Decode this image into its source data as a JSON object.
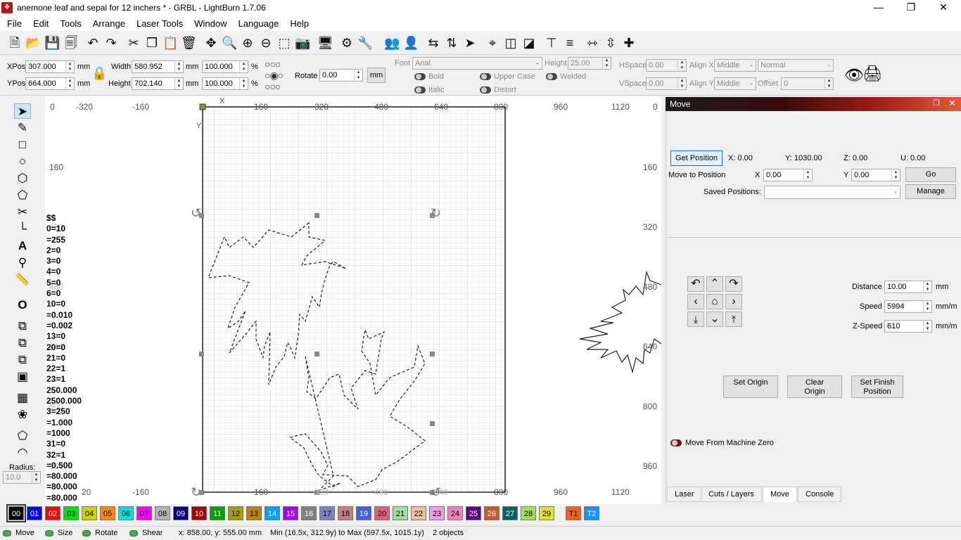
{
  "window": {
    "title": "anemone leaf and sepal for 12 inchers * - GRBL - LightBurn 1.7.06",
    "minimize": "—",
    "maximize": "❐",
    "close": "✕"
  },
  "menu": [
    "File",
    "Edit",
    "Tools",
    "Arrange",
    "Laser Tools",
    "Window",
    "Language",
    "Help"
  ],
  "props": {
    "xpos_label": "XPos",
    "xpos": "307.000",
    "ypos_label": "YPos",
    "ypos": "664.000",
    "unit": "mm",
    "width_label": "Width",
    "width": "580.952",
    "height_label": "Height",
    "height": "702.140",
    "wpct": "100.000",
    "hpct": "100.000",
    "pct": "%",
    "rotate_label": "Rotate",
    "rotate": "0.00",
    "mm_btn": "mm",
    "font_label": "Font",
    "font": "Arial",
    "fheight_label": "Height",
    "fheight": "25.00",
    "hspace_label": "HSpace",
    "hspace": "0.00",
    "vspace_label": "VSpace",
    "vspace": "0.00",
    "alignx_label": "Align X",
    "alignx": "Middle",
    "aligny_label": "Align Y",
    "aligny": "Middle",
    "style": "Normal",
    "offset_label": "Offset",
    "offset": "0",
    "bold": "Bold",
    "italic": "Italic",
    "upper": "Upper Case",
    "distort": "Distort",
    "welded": "Welded"
  },
  "rulers": {
    "top": [
      "0",
      "-320",
      "-160",
      "X",
      "160",
      "320",
      "480",
      "640",
      "800",
      "960",
      "1120",
      "0"
    ],
    "bottom": [
      "20",
      "-160",
      "160",
      "320",
      "480",
      "640",
      "800",
      "960",
      "1120"
    ],
    "left": [
      "160",
      "320",
      "480",
      "640",
      "800",
      "960"
    ],
    "right": [
      "160",
      "320",
      "480",
      "640",
      "800",
      "960"
    ],
    "y": "Y"
  },
  "console_lines": "$$\n0=10\n=255\n2=0\n3=0\n4=0\n5=0\n6=0\n10=0\n=0.010\n=0.002\n13=0\n20=0\n21=0\n22=1\n23=1\n250.000\n2500.000\n3=250\n=1.000\n=1000\n31=0\n32=1\n=0.500\n=80.000\n=80.000\n=80.000",
  "radius": {
    "label": "Radius:",
    "value": "10.0"
  },
  "move": {
    "title": "Move",
    "get_position": "Get Position",
    "x": "X: 0.00",
    "y": "Y: 1030.00",
    "z": "Z: 0.00",
    "u": "U: 0.00",
    "move_to": "Move to Position",
    "mx_label": "X",
    "mx": "0.00",
    "my_label": "Y",
    "my": "0.00",
    "go": "Go",
    "saved": "Saved Positions:",
    "manage": "Manage",
    "distance_label": "Distance",
    "distance": "10.00",
    "distance_unit": "mm",
    "speed_label": "Speed",
    "speed": "5994",
    "speed_unit": "mm/m",
    "zspeed_label": "Z-Speed",
    "zspeed": "610",
    "zspeed_unit": "mm/m",
    "set_origin": "Set Origin",
    "clear_origin": "Clear Origin",
    "set_finish": "Set Finish Position",
    "from_zero": "Move From Machine Zero"
  },
  "tabs": [
    "Laser",
    "Cuts / Layers",
    "Move",
    "Console"
  ],
  "palette": [
    {
      "l": "00",
      "c": "#000000",
      "t": "#ffffff"
    },
    {
      "l": "01",
      "c": "#0000ff",
      "t": "#ffffff"
    },
    {
      "l": "02",
      "c": "#ff0000",
      "t": "#ffffff"
    },
    {
      "l": "03",
      "c": "#00e000",
      "t": "#000000"
    },
    {
      "l": "04",
      "c": "#d0d000",
      "t": "#000000"
    },
    {
      "l": "05",
      "c": "#ff8800",
      "t": "#000000"
    },
    {
      "l": "06",
      "c": "#00e0e0",
      "t": "#000000"
    },
    {
      "l": "07",
      "c": "#ff00ff",
      "t": "#000000"
    },
    {
      "l": "08",
      "c": "#b4b4b4",
      "t": "#000000"
    },
    {
      "l": "09",
      "c": "#000080",
      "t": "#ffffff"
    },
    {
      "l": "10",
      "c": "#a00000",
      "t": "#ffffff"
    },
    {
      "l": "11",
      "c": "#00a000",
      "t": "#ffffff"
    },
    {
      "l": "12",
      "c": "#a0a000",
      "t": "#000000"
    },
    {
      "l": "13",
      "c": "#c08000",
      "t": "#000000"
    },
    {
      "l": "14",
      "c": "#00a0ff",
      "t": "#ffffff"
    },
    {
      "l": "15",
      "c": "#a000ff",
      "t": "#ffffff"
    },
    {
      "l": "16",
      "c": "#808080",
      "t": "#ffffff"
    },
    {
      "l": "17",
      "c": "#8080c0",
      "t": "#000000"
    },
    {
      "l": "18",
      "c": "#c08080",
      "t": "#000000"
    },
    {
      "l": "19",
      "c": "#4060e0",
      "t": "#ffffff"
    },
    {
      "l": "20",
      "c": "#e06080",
      "t": "#000000"
    },
    {
      "l": "21",
      "c": "#a0e0a0",
      "t": "#000000"
    },
    {
      "l": "22",
      "c": "#f0c0a0",
      "t": "#000000"
    },
    {
      "l": "23",
      "c": "#f0a0e0",
      "t": "#000000"
    },
    {
      "l": "24",
      "c": "#f080c0",
      "t": "#000000"
    },
    {
      "l": "25",
      "c": "#600080",
      "t": "#ffffff"
    },
    {
      "l": "26",
      "c": "#c06030",
      "t": "#ffffff"
    },
    {
      "l": "27",
      "c": "#006060",
      "t": "#ffffff"
    },
    {
      "l": "28",
      "c": "#a0e060",
      "t": "#000000"
    },
    {
      "l": "29",
      "c": "#e0e040",
      "t": "#000000"
    },
    {
      "l": "T1",
      "c": "#ff6020",
      "t": "#000000"
    },
    {
      "l": "T2",
      "c": "#2090ff",
      "t": "#ffffff"
    }
  ],
  "status": {
    "move": "Move",
    "size": "Size",
    "rotate": "Rotate",
    "shear": "Shear",
    "coords": "x: 858.00, y: 555.00 mm",
    "bounds": "Min (16.5x, 312.9y) to Max (597.5x, 1015.1y)",
    "objects": "2 objects"
  },
  "icons": {
    "app": "lightburn-logo-icon",
    "lock": "lock-icon"
  }
}
